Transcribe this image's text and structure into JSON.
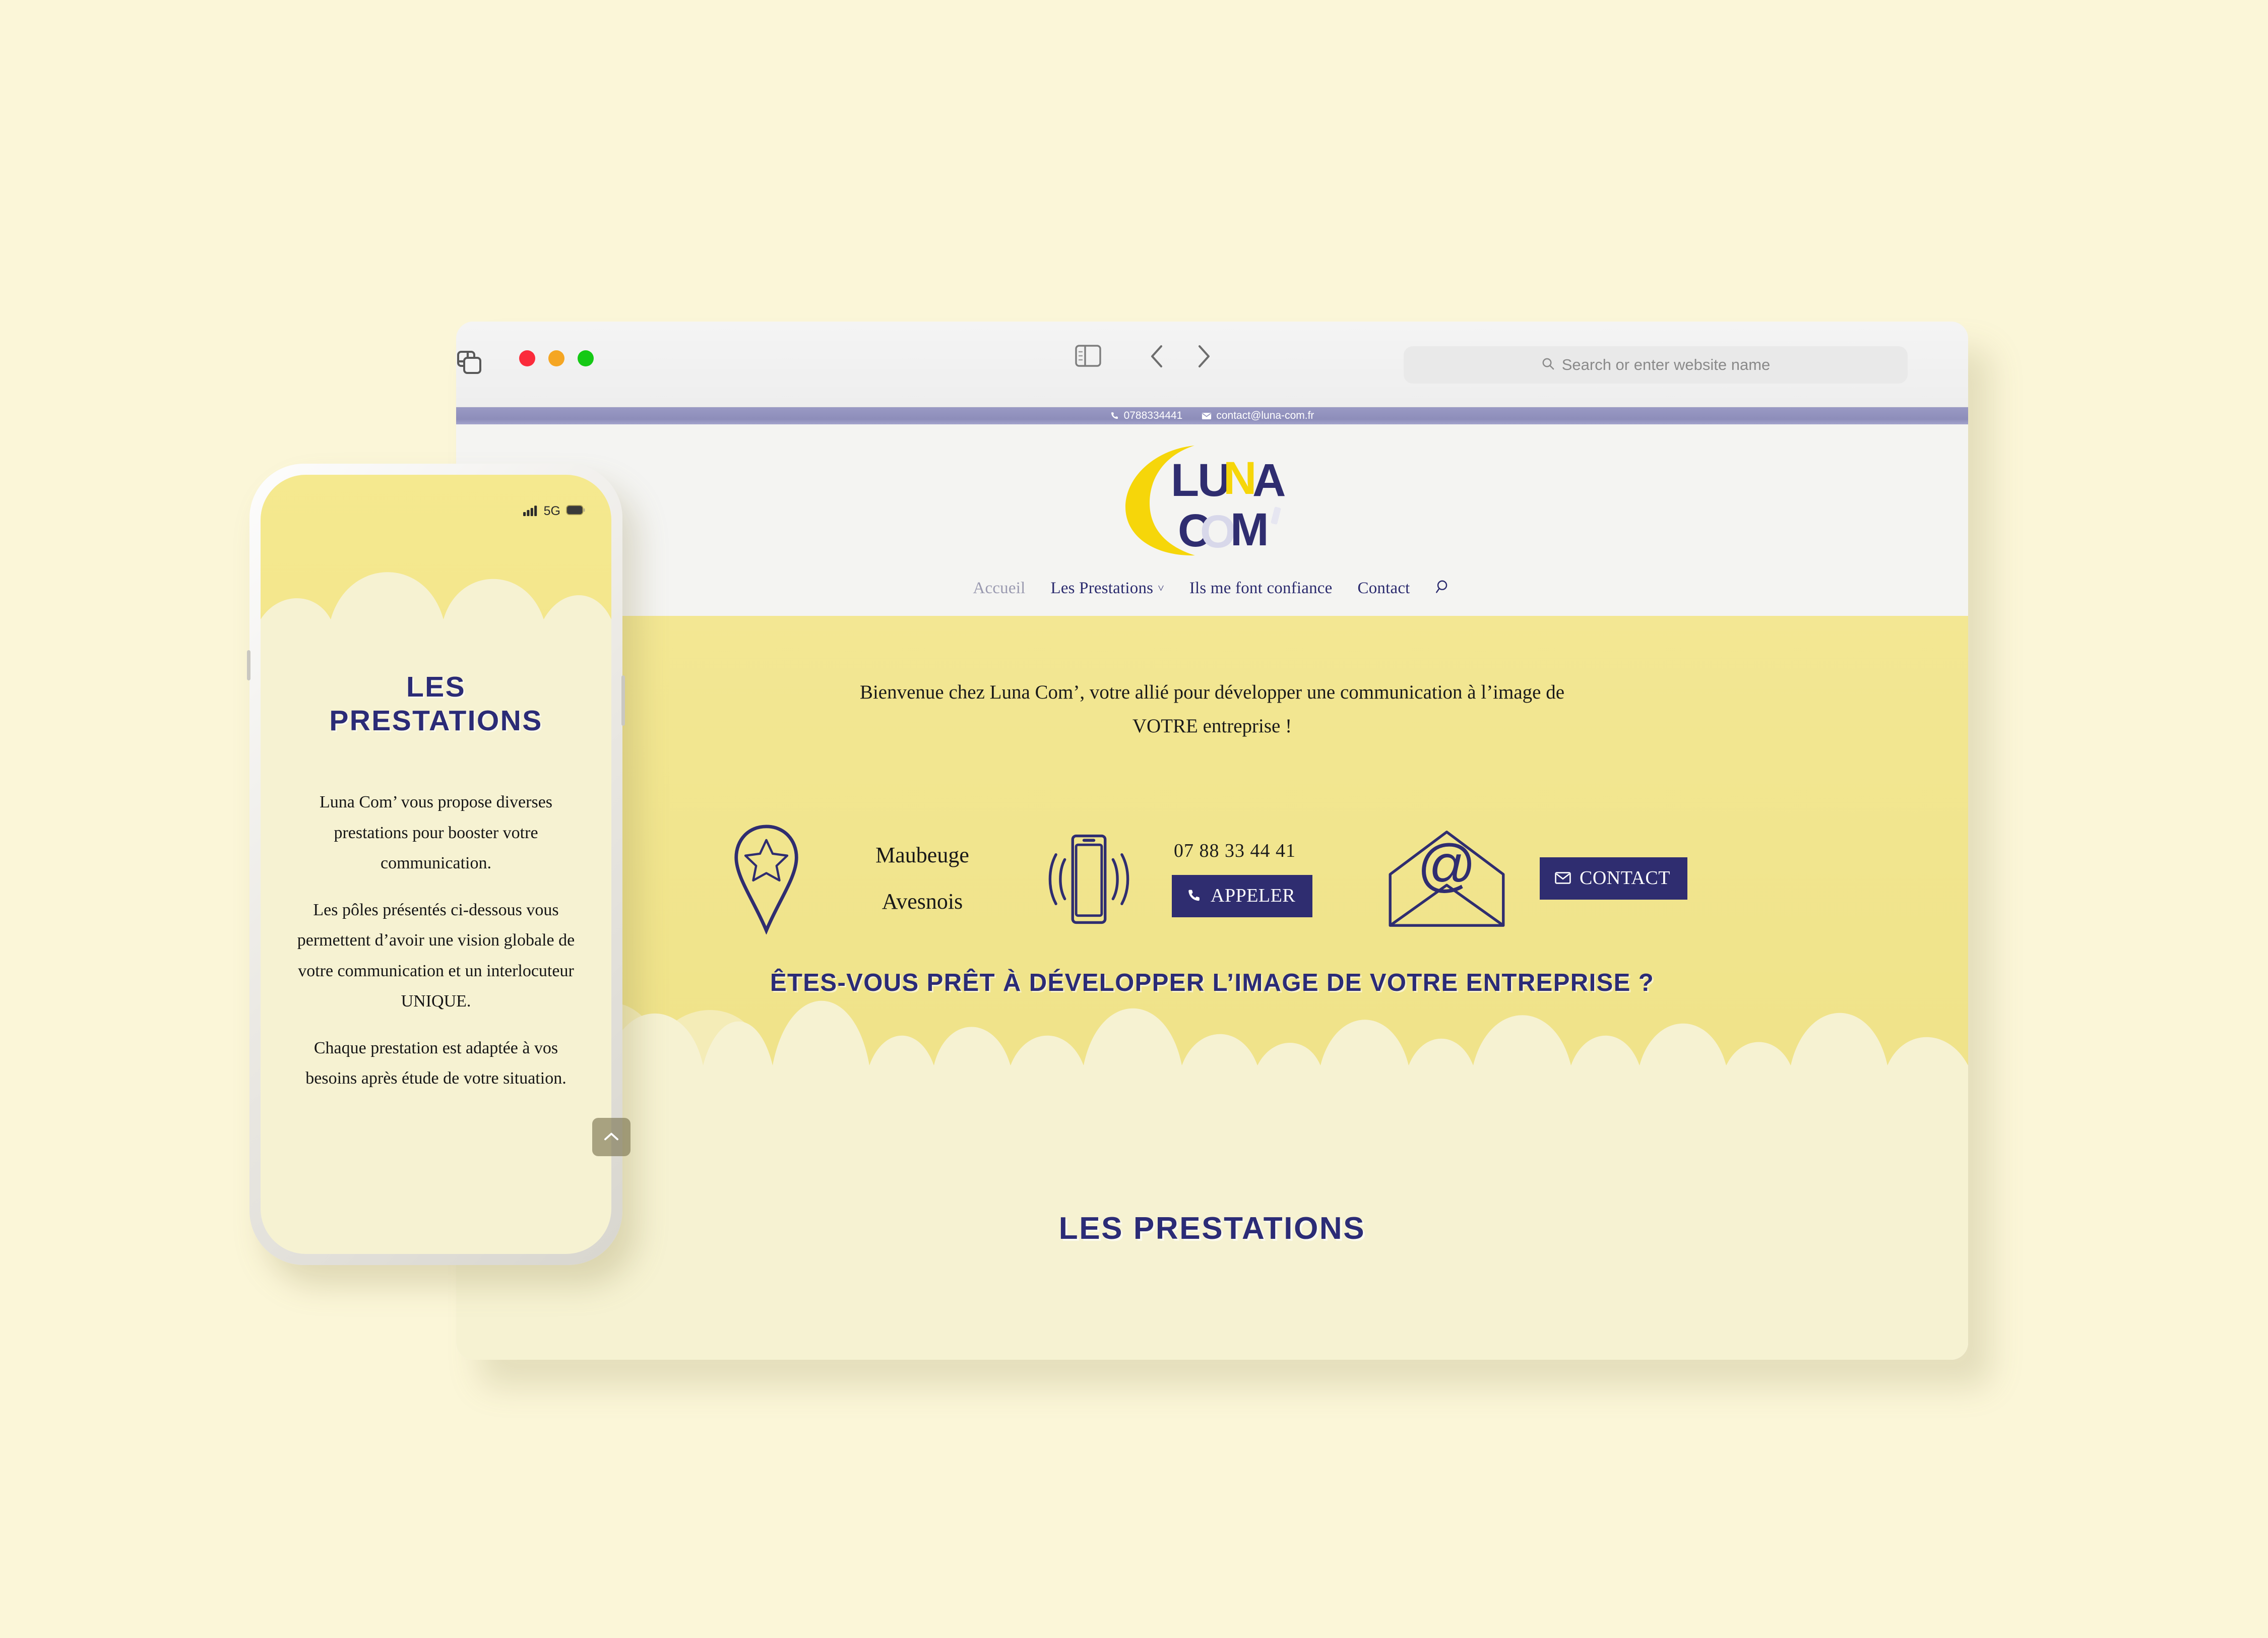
{
  "browser": {
    "address_placeholder": "Search or enter website name",
    "traffic_lights": [
      "close-button",
      "minimize-button",
      "maximize-button"
    ],
    "icons": {
      "sidebar": "sidebar-icon",
      "back": "chevron-left-icon",
      "forward": "chevron-right-icon",
      "search": "search-icon",
      "new_tab": "plus-icon",
      "tab_overview": "tab-overview-icon"
    }
  },
  "site": {
    "topbar": {
      "phone": "0788334441",
      "email": "contact@luna-com.fr"
    },
    "logo": {
      "line1": "LUNA",
      "line2": "COM'",
      "alt": "luna-com-logo"
    },
    "nav": [
      {
        "label": "Accueil",
        "active": true,
        "caret": false
      },
      {
        "label": "Les Prestations",
        "active": false,
        "caret": true
      },
      {
        "label": "Ils me font confiance",
        "active": false,
        "caret": false
      },
      {
        "label": "Contact",
        "active": false,
        "caret": false
      }
    ],
    "hero": {
      "intro_line1": "Bienvenue chez Luna Com’, votre allié pour développer une communication à l’image de",
      "intro_line2": "VOTRE entreprise !",
      "city_line1": "Maubeuge",
      "city_line2": "Avesnois",
      "phone_number": "07 88 33 44 41",
      "call_button": "APPELER",
      "contact_button": "CONTACT",
      "question": "ÊTES-VOUS PRÊT À DÉVELOPPER L’IMAGE DE VOTRE ENTREPRISE ?"
    },
    "prestations": {
      "title": "LES PRESTATIONS"
    }
  },
  "phone": {
    "status": {
      "signal": "signal-bars-icon",
      "network": "5G",
      "battery": "battery-icon"
    },
    "title_line1": "LES",
    "title_line2": "PRESTATIONS",
    "paragraphs": [
      "Luna Com’ vous propose diverses prestations pour booster votre communication.",
      "Les pôles présentés ci-dessous vous permettent d’avoir une vision globale de votre communication et un interlocuteur UNIQUE.",
      "Chaque prestation est adaptée à vos besoins après étude de votre situation."
    ]
  },
  "colors": {
    "navy": "#2b2b76",
    "yellow": "#f4e78d",
    "cream": "#f6f2d2",
    "lavender_bar": "#9a9ac4",
    "page_background": "#fbf6d8"
  }
}
